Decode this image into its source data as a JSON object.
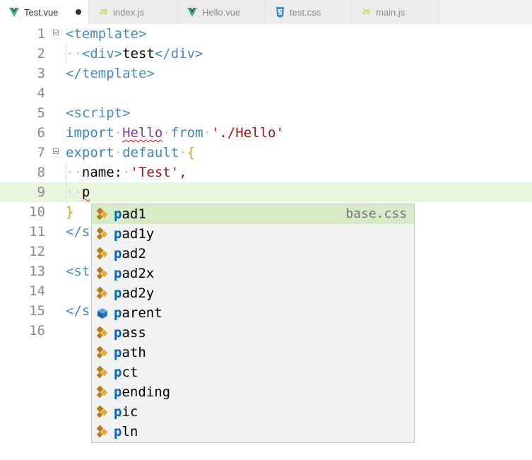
{
  "tabs": [
    {
      "name": "Test.vue",
      "icon": "vue-icon",
      "active": true,
      "dirty": true
    },
    {
      "name": "index.js",
      "icon": "js-icon",
      "badge": "JS"
    },
    {
      "name": "Hello.vue",
      "icon": "vue-icon"
    },
    {
      "name": "test.css",
      "icon": "css-icon"
    },
    {
      "name": "main.js",
      "icon": "js-icon",
      "badge": "JS"
    }
  ],
  "editor": {
    "line_numbers": [
      "1",
      "2",
      "3",
      "4",
      "5",
      "6",
      "7",
      "8",
      "9",
      "10",
      "11",
      "12",
      "13",
      "14",
      "15",
      "16"
    ],
    "current_line": 9,
    "tokens": {
      "l1_tag": "<template>",
      "l2_ws": "··",
      "l2_open": "<div>",
      "l2_text": "test",
      "l2_close": "</div>",
      "l3_tag": "</template>",
      "l5_tag": "<script>",
      "l6_import": "import",
      "l6_ws1": "·",
      "l6_hello": "Hello",
      "l6_ws2": "·",
      "l6_from": "from",
      "l6_ws3": "·",
      "l6_str": "'./Hello'",
      "l7_export": "export",
      "l7_ws1": "·",
      "l7_default": "default",
      "l7_ws2": "·",
      "l7_brace": "{",
      "l8_ws1": "··",
      "l8_name": "name:",
      "l8_ws2": "·",
      "l8_str": "'Test',",
      "l9_ws": "··",
      "l9_typed": "p",
      "l10_brace": "}",
      "l11_partial": "</s",
      "l13_partial": "<st",
      "l15_partial": "</s"
    }
  },
  "suggestions": {
    "typed_prefix": "p",
    "items": [
      {
        "rest": "ad1",
        "icon": "snippet-icon",
        "detail": "base.css"
      },
      {
        "rest": "ad1y",
        "icon": "snippet-icon"
      },
      {
        "rest": "ad2",
        "icon": "snippet-icon"
      },
      {
        "rest": "ad2x",
        "icon": "snippet-icon"
      },
      {
        "rest": "ad2y",
        "icon": "snippet-icon"
      },
      {
        "rest": "arent",
        "icon": "field-icon"
      },
      {
        "rest": "ass",
        "icon": "snippet-icon"
      },
      {
        "rest": "ath",
        "icon": "snippet-icon"
      },
      {
        "rest": "ct",
        "icon": "snippet-icon"
      },
      {
        "rest": "ending",
        "icon": "snippet-icon"
      },
      {
        "rest": "ic",
        "icon": "snippet-icon"
      },
      {
        "rest": "ln",
        "icon": "snippet-icon"
      }
    ],
    "selected_index": 0
  },
  "colors": {
    "vue_green": "#41b883",
    "js_yellow": "#cbcb41",
    "css_blue": "#3d8fd1",
    "current_line": "#e8f5dc",
    "suggest_selected": "#d6ebc6",
    "match_highlight": "#0066bf"
  }
}
